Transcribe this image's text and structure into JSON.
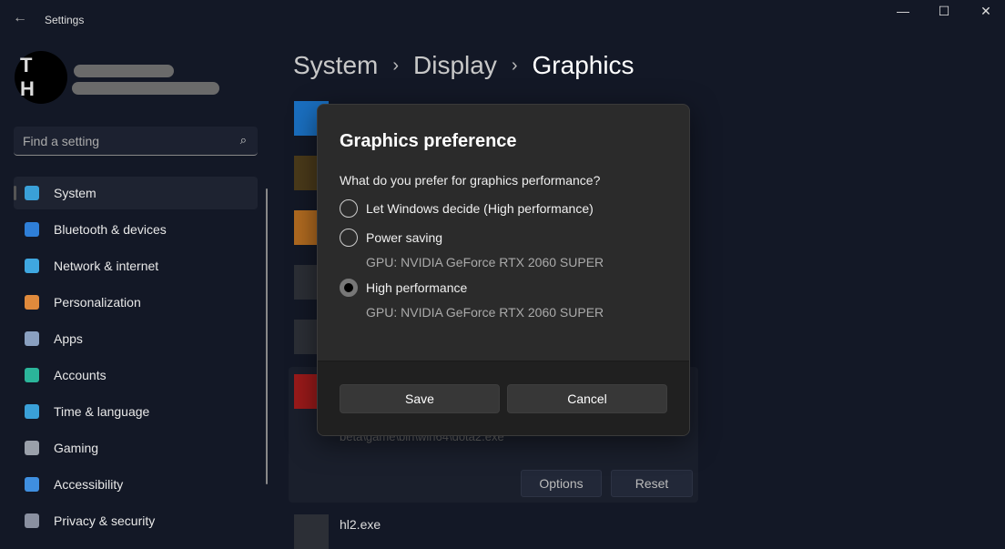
{
  "window": {
    "title": "Settings",
    "back": "←",
    "minimize": "—",
    "maximize": "☐",
    "close": "✕"
  },
  "profile": {
    "initials": "T H"
  },
  "search": {
    "placeholder": "Find a setting",
    "icon": "⌕"
  },
  "sidebar": {
    "items": [
      {
        "label": "System",
        "color": "#3aa0d8"
      },
      {
        "label": "Bluetooth & devices",
        "color": "#2f7fd8"
      },
      {
        "label": "Network & internet",
        "color": "#3fa7e0"
      },
      {
        "label": "Personalization",
        "color": "#e08a3c"
      },
      {
        "label": "Apps",
        "color": "#8aa0c0"
      },
      {
        "label": "Accounts",
        "color": "#2bb59a"
      },
      {
        "label": "Time & language",
        "color": "#3aa0d8"
      },
      {
        "label": "Gaming",
        "color": "#9aa0aa"
      },
      {
        "label": "Accessibility",
        "color": "#3f8fe0"
      },
      {
        "label": "Privacy & security",
        "color": "#8a90a0"
      }
    ]
  },
  "breadcrumb": [
    "System",
    "Display",
    "Graphics"
  ],
  "background": {
    "path_fragment": "beta\\game\\bin\\win64\\dota2.exe",
    "options": "Options",
    "reset": "Reset",
    "next_app": "hl2.exe"
  },
  "dialog": {
    "title": "Graphics preference",
    "question": "What do you prefer for graphics performance?",
    "options": [
      {
        "label": "Let Windows decide (High performance)",
        "selected": false
      },
      {
        "label": "Power saving",
        "gpu": "GPU: NVIDIA GeForce RTX 2060 SUPER",
        "selected": false
      },
      {
        "label": "High performance",
        "gpu": "GPU: NVIDIA GeForce RTX 2060 SUPER",
        "selected": true
      }
    ],
    "save": "Save",
    "cancel": "Cancel"
  }
}
